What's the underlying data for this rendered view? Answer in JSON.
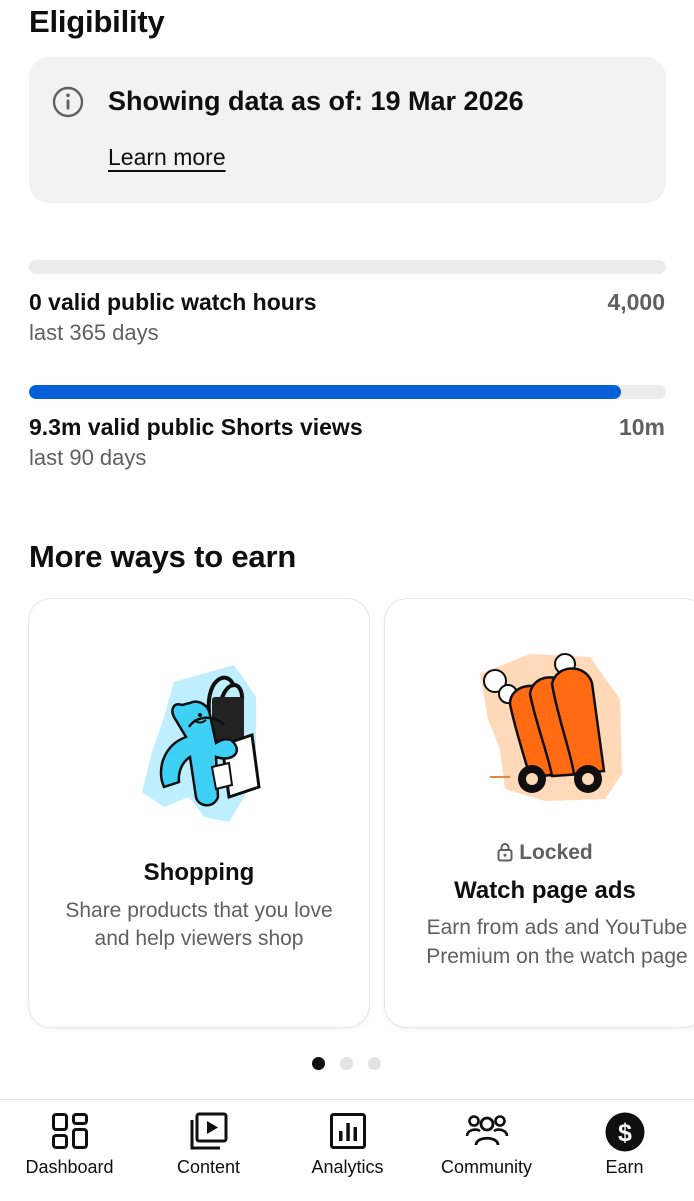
{
  "eligibility": {
    "title": "Eligibility",
    "info_text": "Showing data as of: 19 Mar 2026",
    "learn_more": "Learn more"
  },
  "metrics": [
    {
      "label": "0 valid public watch hours",
      "sublabel": "last 365 days",
      "target": "4,000",
      "progress": 0.0
    },
    {
      "label": "9.3m valid public Shorts views",
      "sublabel": "last 90 days",
      "target": "10m",
      "progress": 0.93
    }
  ],
  "more_ways": {
    "title": "More ways to earn",
    "cards": [
      {
        "title": "Shopping",
        "description_line1": "Share products that you love",
        "description_line2": "and help viewers shop",
        "locked": false
      },
      {
        "title": "Watch page ads",
        "locked_label": "Locked",
        "description_line1": "Earn from ads and YouTube",
        "description_line2": "Premium on the watch page",
        "locked": true
      }
    ],
    "pagination": {
      "count": 3,
      "active": 0
    }
  },
  "nav": {
    "items": [
      {
        "label": "Dashboard",
        "icon": "dashboard-icon"
      },
      {
        "label": "Content",
        "icon": "content-icon"
      },
      {
        "label": "Analytics",
        "icon": "analytics-icon"
      },
      {
        "label": "Community",
        "icon": "community-icon"
      },
      {
        "label": "Earn",
        "icon": "earn-icon",
        "active": true
      }
    ]
  },
  "colors": {
    "accent_blue": "#065fd4",
    "shopping_illustration": "#3ed0f5",
    "ads_illustration": "#ff6a13"
  }
}
